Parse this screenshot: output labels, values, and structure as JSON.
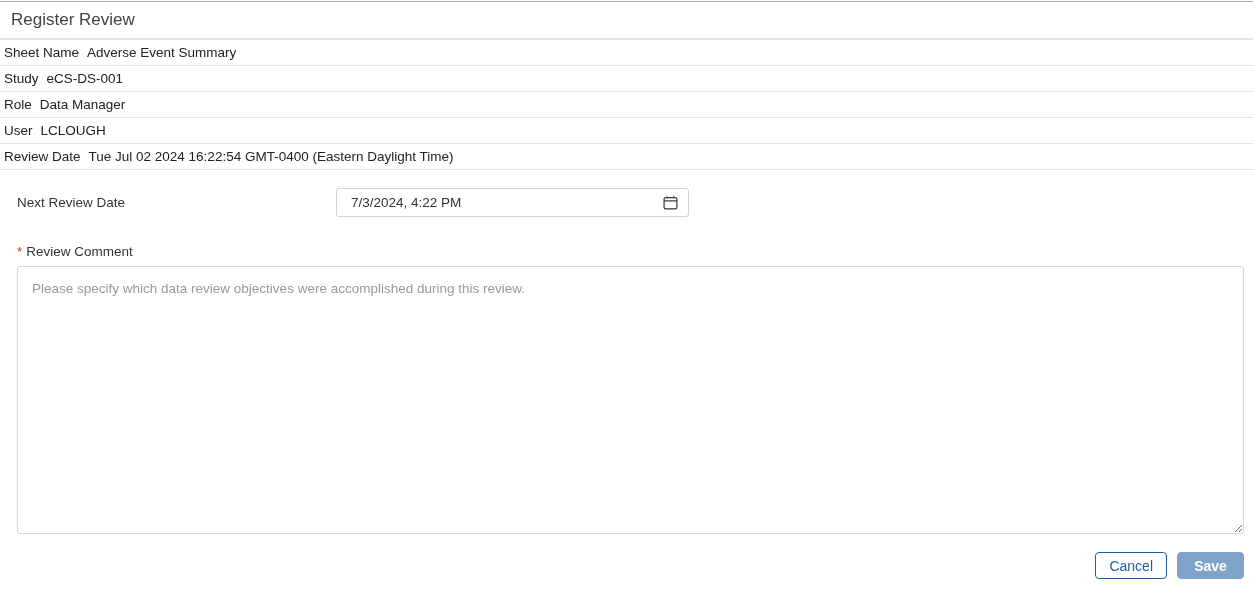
{
  "title": "Register Review",
  "details": [
    {
      "label": "Sheet Name",
      "value": "Adverse Event Summary"
    },
    {
      "label": "Study",
      "value": "eCS-DS-001"
    },
    {
      "label": "Role",
      "value": "Data Manager"
    },
    {
      "label": "User",
      "value": "LCLOUGH"
    },
    {
      "label": "Review Date",
      "value": "Tue Jul 02 2024 16:22:54 GMT-0400 (Eastern Daylight Time)"
    }
  ],
  "next_review_date": {
    "label": "Next Review Date",
    "value": "7/3/2024, 4:22 PM"
  },
  "review_comment": {
    "label": "Review Comment",
    "required": true,
    "required_mark": "*",
    "placeholder": "Please specify which data review objectives were accomplished during this review."
  },
  "buttons": [
    {
      "label": "Cancel",
      "kind": "secondary",
      "disabled": false
    },
    {
      "label": "Save",
      "kind": "primary",
      "disabled": true
    }
  ]
}
